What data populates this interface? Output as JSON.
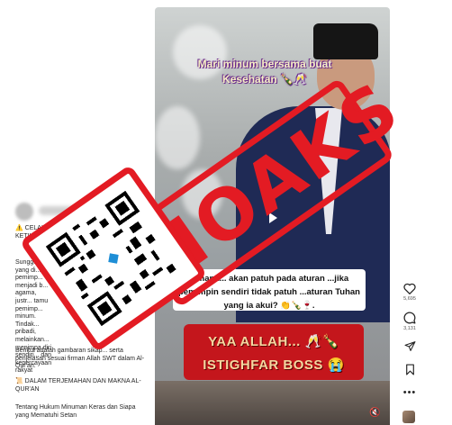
{
  "post": {
    "caption_warning": "⚠️ CELAKA TUHAN AKAN MENGHUKUMMU KETIKA SYARIAT...",
    "caption_body": "Sungguh... yang di... pemimp... menjadi b... agama, justr... tamu pemimp... minum. Tindak... pribadi, melainkan... menimpa diri sendiri... dan kepercayaan rakyat",
    "caption_tail": "Berikut adalah gambaran sikap... serta penjelasan sesuai firman Allah SWT dalam Al-Qur'an:",
    "caption_quran": "📜 DALAM TERJEMAHAN DAN MAKNA AL-QUR'AN",
    "caption_law": "Tentang Hukum Minuman Keras dan Siapa yang Mematuhi Setan"
  },
  "video": {
    "overlay_top": "Mari minum bersama buat Kesehatan 🍾🥂",
    "overlay_box": "...mana... akan patuh pada aturan ...jika pemimpin sendiri tidak patuh ...aturan Tuhan yang ia akui? 👏🍾🍷.",
    "overlay_red_line1": "YAA ALLAH... 🥂🍾",
    "overlay_red_line2": "ISTIGHFAR BOSS 😭"
  },
  "actions": {
    "like_count": "5,695",
    "comment_count": "3,131"
  },
  "stamp": {
    "text": "HOAKS",
    "color": "#e31b23"
  },
  "icons": [
    "heart-icon",
    "comment-icon",
    "share-icon",
    "bookmark-icon",
    "more-icon",
    "play-icon",
    "mute-icon",
    "qr-code"
  ]
}
